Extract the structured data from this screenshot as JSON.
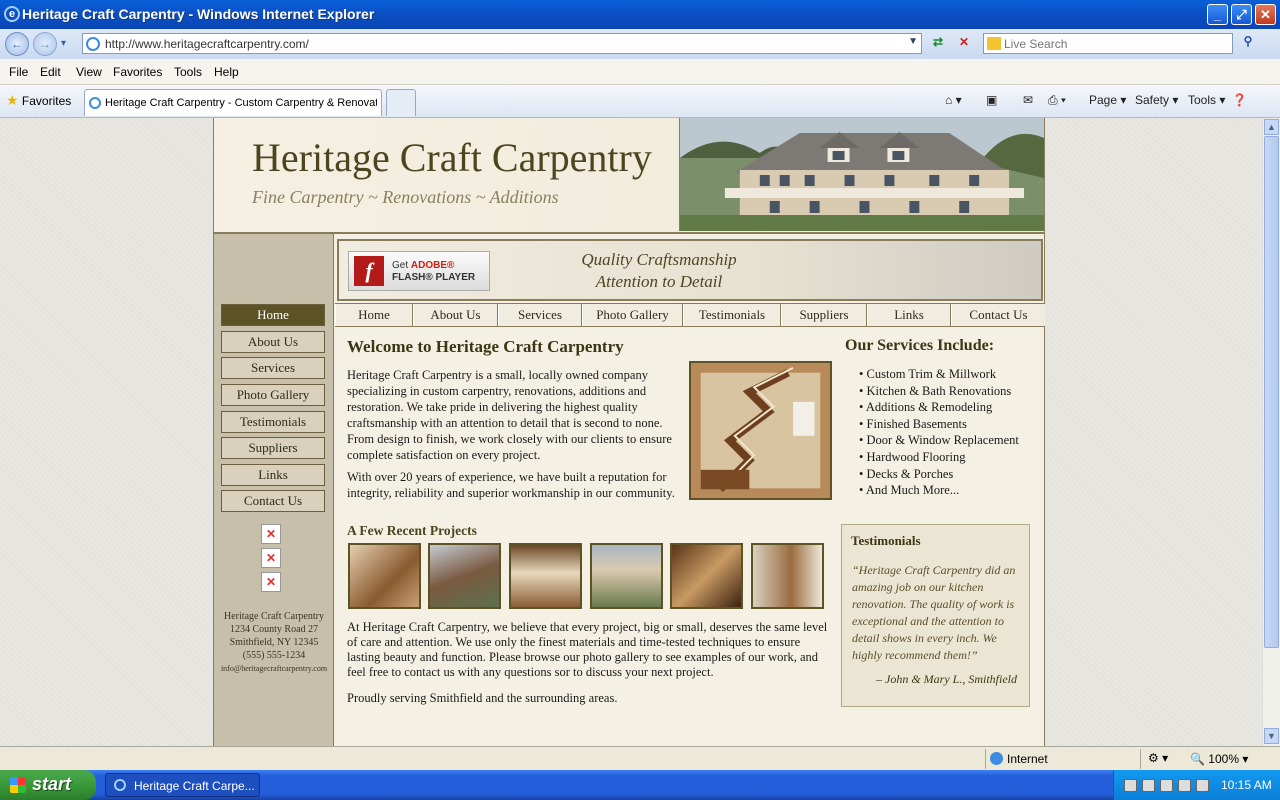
{
  "window": {
    "title": "Heritage Craft Carpentry - Windows Internet Explorer",
    "minimize": "_",
    "maximize": "⤢",
    "close": "✕"
  },
  "address": {
    "url": "http://www.heritagecraftcarpentry.com/",
    "search_placeholder": "Live Search"
  },
  "menu": [
    "File",
    "Edit",
    "View",
    "Favorites",
    "Tools",
    "Help"
  ],
  "tabs": {
    "favorites_label": "Favorites",
    "active_tab_label": "Heritage Craft Carpentry - Custom Carpentry & Renovations"
  },
  "commandbar": {
    "page": "Page ▾",
    "safety": "Safety ▾",
    "tools": "Tools ▾"
  },
  "site": {
    "title": "Heritage Craft Carpentry",
    "tagline": "Fine Carpentry ~ Renovations ~ Additions",
    "flash_get": "Get",
    "flash_adobe": "ADOBE®",
    "flash_player": "FLASH® PLAYER",
    "banner_line1": "Quality Craftsmanship",
    "banner_line2": "Attention to Detail",
    "sidenav": [
      "Home",
      "About Us",
      "Services",
      "Photo Gallery",
      "Testimonials",
      "Suppliers",
      "Links",
      "Contact Us"
    ],
    "topnav": [
      "Home",
      "About Us",
      "Services",
      "Photo Gallery",
      "Testimonials",
      "Suppliers",
      "Links",
      "Contact Us"
    ],
    "sidebar_address": {
      "name": "Heritage Craft Carpentry",
      "street": "1234 County Road 27",
      "city": "Smithfield, NY 12345",
      "phone": "(555) 555-1234",
      "email": "info@heritagecraftcarpentry.com"
    },
    "welcome_heading": "Welcome to Heritage Craft Carpentry",
    "welcome_p1": "Heritage Craft Carpentry is a small, locally owned company specializing in custom carpentry, renovations, additions and restoration. We take pride in delivering the highest quality craftsmanship with an attention to detail that is second to none. From design to finish, we work closely with our clients to ensure complete satisfaction on every project.",
    "welcome_p2": "With over 20 years of experience, we have built a reputation for integrity, reliability and superior workmanship in our community.",
    "services_heading": "Our Services Include:",
    "services": [
      "Custom Trim & Millwork",
      "Kitchen & Bath Renovations",
      "Additions & Remodeling",
      "Finished Basements",
      "Door & Window Replacement",
      "Hardwood Flooring",
      "Decks & Porches",
      "And Much More..."
    ],
    "recent_heading": "A Few Recent Projects",
    "body_p3": "At Heritage Craft Carpentry, we believe that every project, big or small, deserves the same level of care and attention. We use only the finest materials and time-tested techniques to ensure lasting beauty and function. Please browse our photo gallery to see examples of our work, and feel free to contact us with any questions sor to discuss your next project.",
    "body_p4": "Proudly serving Smithfield and the surrounding areas.",
    "testimonials_heading": "Testimonials",
    "testimonial_quote": "“Heritage Craft Carpentry did an amazing job on our kitchen renovation. The quality of work is exceptional and the attention to detail shows in every inch. We highly recommend them!”",
    "testimonial_author": "– John & Mary L., Smithfield"
  },
  "status": {
    "zone": "Internet",
    "zoom": "100%"
  },
  "taskbar": {
    "start": "start",
    "task_label": "Heritage Craft Carpe...",
    "clock": "10:15 AM"
  }
}
